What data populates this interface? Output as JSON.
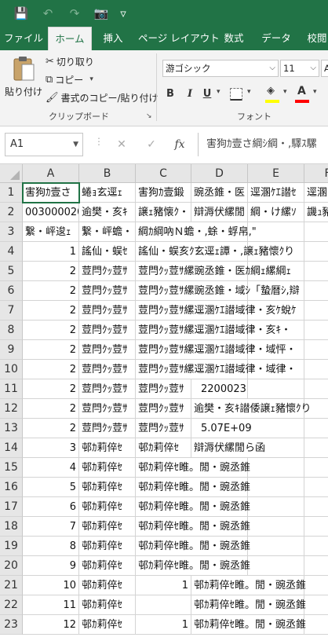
{
  "colors": {
    "brand": "#217346",
    "grid": "#d4d4d4",
    "header_bg": "#e6e6e6"
  },
  "qat": [
    {
      "name": "save-icon",
      "glyph": "💾"
    },
    {
      "name": "undo-icon",
      "glyph": "↶"
    },
    {
      "name": "redo-icon",
      "glyph": "↷"
    },
    {
      "name": "camera-icon",
      "glyph": "📷"
    },
    {
      "name": "customize-qat-icon",
      "glyph": "▿"
    }
  ],
  "tabs": [
    "ファイル",
    "ホーム",
    "挿入",
    "ページ レイアウト",
    "数式",
    "データ",
    "校閲"
  ],
  "clipboard": {
    "paste": "貼り付け",
    "cut": "切り取り",
    "copy": "コピー",
    "format_painter": "書式のコピー/貼り付け",
    "group": "クリップボード"
  },
  "font": {
    "name": "游ゴシック",
    "size": "11",
    "bold": "B",
    "italic": "I",
    "underline": "U",
    "group": "フォント"
  },
  "formula_bar": {
    "name_box": "A1",
    "cancel": "✕",
    "enter": "✓",
    "fx": "fx",
    "value": "害狗ｶ壹さ綱ｼ綱・,驛ｽ騾"
  },
  "columns": [
    "A",
    "B",
    "C",
    "D",
    "E",
    "F"
  ],
  "rows": [
    {
      "n": "1",
      "cells": [
        "害狗ｶ壹さ",
        "蜷ｮ玄逕ｪ",
        "害狗ｶ壹鍛",
        "豌丞錐・医",
        "逕溷ｹｴ譛ｾ",
        "逕溷"
      ]
    },
    {
      "n": "2",
      "cells": [
        "003000020",
        "逾樊・亥ｷ",
        "譲ｪ豬懐ｸ・",
        "辯溽伏縲閒",
        "綱・け縲ｿ",
        "譏ｭ豬"
      ]
    },
    {
      "n": "3",
      "cells": [
        "繋・岼逡ｪ",
        "繋・岼蟾・",
        "綱ｶ綱吶Ｎ蟾・,蜍・蜉帛,\"",
        "",
        "",
        ""
      ]
    },
    {
      "n": "4",
      "cells": [
        "1",
        "謠仙・蜈ｾ",
        "謠仙・蜈亥ｸ玄逕ｪ譚・,譲ｪ豬懷ｸり",
        "",
        "",
        ""
      ]
    },
    {
      "n": "5",
      "cells": [
        "2",
        "荳閂ｸｯ荳ｻ",
        "荳閂ｸｯ荳ｻ縲豌丞錐・医ｶ綱ｪ縲綱ｪ",
        "",
        "",
        ""
      ]
    },
    {
      "n": "6",
      "cells": [
        "2",
        "荳閂ｸｯ荳ｻ",
        "荳閂ｸｯ荳ｻ縲豌丞錐・域ｼ「蟄暦ｼ,辯",
        "",
        "",
        ""
      ]
    },
    {
      "n": "7",
      "cells": [
        "2",
        "荳閂ｸｯ荳ｻ",
        "荳閂ｸｯ荳ｻ縲逕溷ｹｴ譛域律・亥ｹ蛻ｹ",
        "",
        "",
        ""
      ]
    },
    {
      "n": "8",
      "cells": [
        "2",
        "荳閂ｸｯ荳ｻ",
        "荳閂ｸｯ荳ｻ縲逕溷ｹｴ譛域律・亥ｷ・",
        "",
        "",
        ""
      ]
    },
    {
      "n": "9",
      "cells": [
        "2",
        "荳閂ｸｯ荳ｻ",
        "荳閂ｸｯ荳ｻ縲逕溷ｹｴ譛域律・域怦・",
        "",
        "",
        ""
      ]
    },
    {
      "n": "10",
      "cells": [
        "2",
        "荳閂ｸｯ荳ｻ",
        "荳閂ｸｯ荳ｻ縲逕溷ｹｴ譛域律・域律・",
        "",
        "",
        ""
      ]
    },
    {
      "n": "11",
      "cells": [
        "2",
        "荳閂ｸｯ荳ｻ",
        "荳閂ｸｯ荳ｻ",
        "2200023",
        "",
        ""
      ]
    },
    {
      "n": "12",
      "cells": [
        "2",
        "荳閂ｸｯ荳ｻ",
        "荳閂ｸｯ荳ｻ",
        "逾樊・亥ｷ譛倭譲ｪ豬懷ｸり",
        "",
        ""
      ]
    },
    {
      "n": "13",
      "cells": [
        "2",
        "荳閂ｸｯ荳ｻ",
        "荳閂ｸｯ荳ｻ",
        "5.07E+09",
        "",
        ""
      ]
    },
    {
      "n": "14",
      "cells": [
        "3",
        "邨ｶ莉倅ｾ",
        "邨ｶ莉倅ｾ",
        "辯溽伏縲閒ら函",
        "",
        ""
      ]
    },
    {
      "n": "15",
      "cells": [
        "4",
        "邨ｶ莉倅ｾ",
        "邨ｶ莉倅ｾ睢。閒・豌丞錐",
        "",
        "",
        ""
      ]
    },
    {
      "n": "16",
      "cells": [
        "5",
        "邨ｶ莉倅ｾ",
        "邨ｶ莉倅ｾ睢。閒・豌丞錐",
        "",
        "",
        ""
      ]
    },
    {
      "n": "17",
      "cells": [
        "6",
        "邨ｶ莉倅ｾ",
        "邨ｶ莉倅ｾ睢。閒・豌丞錐",
        "",
        "",
        ""
      ]
    },
    {
      "n": "18",
      "cells": [
        "7",
        "邨ｶ莉倅ｾ",
        "邨ｶ莉倅ｾ睢。閒・豌丞錐",
        "",
        "",
        ""
      ]
    },
    {
      "n": "19",
      "cells": [
        "8",
        "邨ｶ莉倅ｾ",
        "邨ｶ莉倅ｾ睢。閒・豌丞錐",
        "",
        "",
        ""
      ]
    },
    {
      "n": "20",
      "cells": [
        "9",
        "邨ｶ莉倅ｾ",
        "邨ｶ莉倅ｾ睢。閒・豌丞錐",
        "",
        "",
        ""
      ]
    },
    {
      "n": "21",
      "cells": [
        "10",
        "邨ｶ莉倅ｾ",
        "1",
        "邨ｶ莉倅ｾ睢。閒・豌丞錐",
        "",
        ""
      ]
    },
    {
      "n": "22",
      "cells": [
        "11",
        "邨ｶ莉倅ｾ",
        "",
        "邨ｶ莉倅ｾ睢。閒・豌丞錐",
        "",
        ""
      ]
    },
    {
      "n": "23",
      "cells": [
        "12",
        "邨ｶ莉倅ｾ",
        "1",
        "邨ｶ莉倅ｾ睢。閒・豌丞錐",
        "",
        ""
      ]
    }
  ]
}
